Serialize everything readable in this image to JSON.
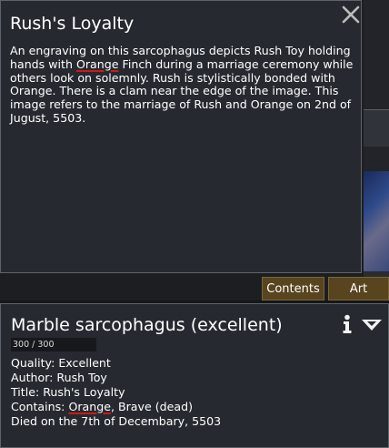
{
  "art_window": {
    "title": "Rush's Loyalty",
    "description": {
      "part1": "An engraving on this sarcophagus depicts Rush Toy holding hands with ",
      "link1": "Orange",
      "part2": " Finch during a marriage ceremony while others look on solemnly. Rush is stylistically bonded with Orange. There is a clam near the edge of the image. This image refers to the marriage of Rush and Orange on 2nd of Jugust, 5503."
    },
    "close_icon": "close-icon"
  },
  "tabs": [
    {
      "label": "Contents"
    },
    {
      "label": "Art"
    }
  ],
  "inspect": {
    "title": "Marble sarcophagus (excellent)",
    "hit_points": "300 / 300",
    "hit_points_fraction": 1.0,
    "quality": "Quality: Excellent",
    "author": "Author: Rush Toy",
    "art_title": "Title: Rush's Loyalty",
    "contains_prefix": "Contains: ",
    "contains_link": "Orange",
    "contains_suffix": ", Brave (dead)",
    "died": "Died on the 7th of Decembary, 5503",
    "info_icon": "info-icon",
    "menu_icon": "dropdown-arrow-icon"
  },
  "colors": {
    "panel_bg": "#262a30",
    "tab_bg": "#58451f",
    "underline": "#d01818"
  }
}
